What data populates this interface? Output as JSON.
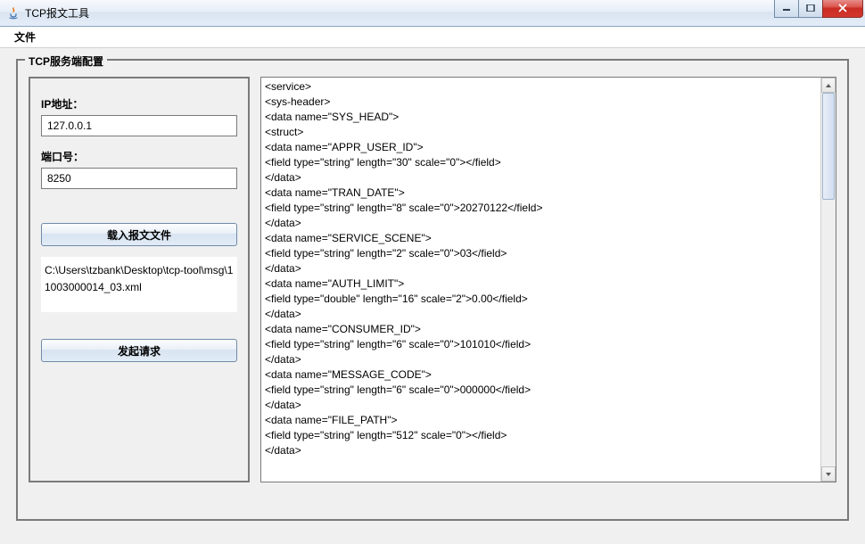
{
  "titlebar": {
    "app_title": "TCP报文工具"
  },
  "menu": {
    "file": "文件"
  },
  "group": {
    "title": "TCP服务端配置"
  },
  "left": {
    "ip_label": "IP地址：",
    "ip_value": "127.0.0.1",
    "port_label": "端口号：",
    "port_value": "8250",
    "load_btn": "载入报文文件",
    "file_path": "C:\\Users\\tzbank\\Desktop\\tcp-tool\\msg\\11003000014_03.xml",
    "send_btn": "发起请求"
  },
  "payload_lines": [
    "<service>",
    "<sys-header>",
    "<data name=\"SYS_HEAD\">",
    "<struct>",
    "<data name=\"APPR_USER_ID\">",
    "<field type=\"string\" length=\"30\" scale=\"0\"></field>",
    "</data>",
    "<data name=\"TRAN_DATE\">",
    "<field type=\"string\" length=\"8\" scale=\"0\">20270122</field>",
    "</data>",
    "<data name=\"SERVICE_SCENE\">",
    "<field type=\"string\" length=\"2\" scale=\"0\">03</field>",
    "</data>",
    "<data name=\"AUTH_LIMIT\">",
    "<field type=\"double\" length=\"16\" scale=\"2\">0.00</field>",
    "</data>",
    "<data name=\"CONSUMER_ID\">",
    "<field type=\"string\" length=\"6\" scale=\"0\">101010</field>",
    "</data>",
    "<data name=\"MESSAGE_CODE\">",
    "<field type=\"string\" length=\"6\" scale=\"0\">000000</field>",
    "</data>",
    "<data name=\"FILE_PATH\">",
    "<field type=\"string\" length=\"512\" scale=\"0\"></field>",
    "</data>"
  ]
}
